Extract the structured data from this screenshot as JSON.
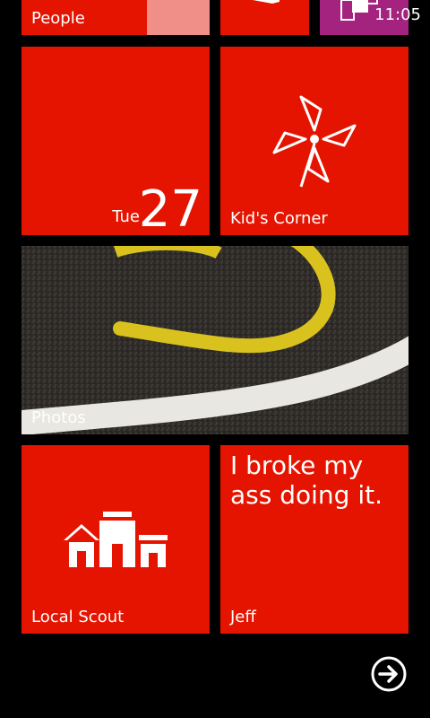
{
  "status_bar": {
    "time": "11:05"
  },
  "tiles": {
    "people": {
      "label": "People"
    },
    "calendar": {
      "day": "Tue",
      "date": "27"
    },
    "kids_corner": {
      "label": "Kid's Corner"
    },
    "photos": {
      "label": "Photos"
    },
    "local_scout": {
      "label": "Local Scout"
    },
    "jeff": {
      "message": "I broke my ass doing it.",
      "label": "Jeff"
    }
  },
  "colors": {
    "accent": "#e51400",
    "purple": "#a4237f",
    "background": "#000000"
  },
  "icons": [
    "office-icon",
    "pinwheel-icon",
    "local-scout-icon",
    "arrow-right-icon",
    "notification-icons"
  ]
}
